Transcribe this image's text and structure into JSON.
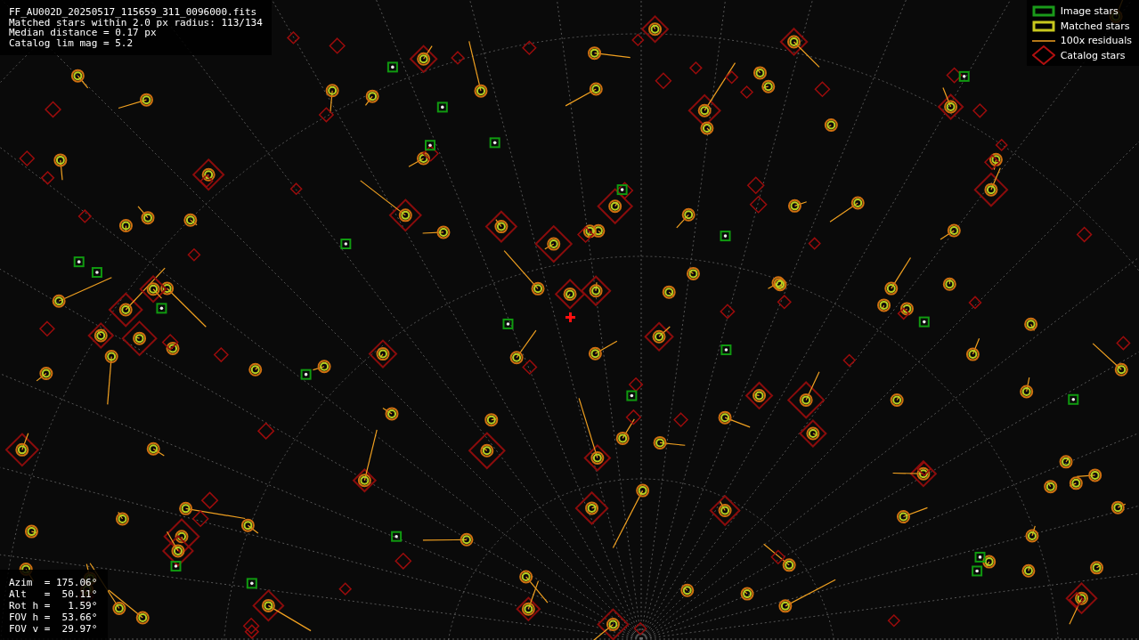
{
  "info_lines": [
    "FF_AU002D_20250517_115659_311_0096000.fits",
    "Matched stars within 2.0 px radius: 113/134",
    "Median distance = 0.17 px",
    "Catalog lim mag = 5.2"
  ],
  "legend": [
    {
      "kind": "image",
      "label": "Image stars"
    },
    {
      "kind": "matched",
      "label": "Matched stars"
    },
    {
      "kind": "residual",
      "label": "100x residuals"
    },
    {
      "kind": "catalog",
      "label": "Catalog stars"
    }
  ],
  "pointing": [
    "Azim  = 175.06°",
    "Alt   =  50.11°",
    "Rot h =   1.59°",
    "FOV h =  53.66°",
    "FOV v =  29.97°"
  ]
}
